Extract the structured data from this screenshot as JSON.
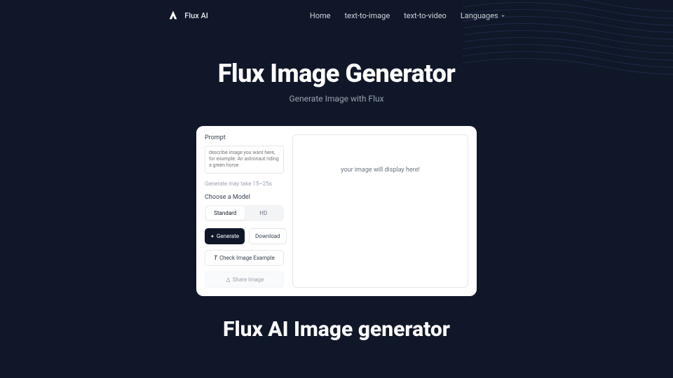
{
  "header": {
    "brand": "Flux AI",
    "nav": {
      "home": "Home",
      "text_to_image": "text-to-image",
      "text_to_video": "text-to-video",
      "languages": "Languages"
    }
  },
  "hero": {
    "title": "Flux Image Generator",
    "subtitle": "Generate Image with Flux"
  },
  "form": {
    "prompt_label": "Prompt",
    "prompt_placeholder": "describe image you want here, for example: An astronaut riding a green horse",
    "hint": "Generate may take 15~25s",
    "model_label": "Choose a Model",
    "model_standard": "Standard",
    "model_hd": "HD",
    "generate_btn": "Generate",
    "download_btn": "Download",
    "check_example_btn": "Check Image Example",
    "share_btn": "Share Image"
  },
  "preview": {
    "placeholder": "your image will display here!"
  },
  "section": {
    "title": "Flux AI Image generator"
  }
}
